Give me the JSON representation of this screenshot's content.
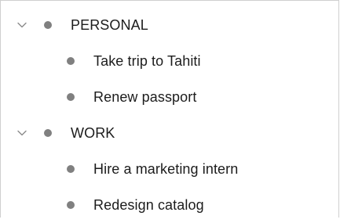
{
  "outline": {
    "groups": [
      {
        "label": "PERSONAL",
        "chevron_icon": "chevron-down-icon",
        "children": [
          {
            "label": "Take trip to Tahiti"
          },
          {
            "label": "Renew passport"
          }
        ]
      },
      {
        "label": "WORK",
        "chevron_icon": "chevron-down-icon",
        "children": [
          {
            "label": "Hire a marketing intern"
          },
          {
            "label": "Redesign catalog"
          }
        ]
      }
    ]
  },
  "colors": {
    "bullet": "#808080",
    "chevron": "#8a8a8a",
    "text": "#1c1c1c",
    "border": "#cfcfcf"
  }
}
